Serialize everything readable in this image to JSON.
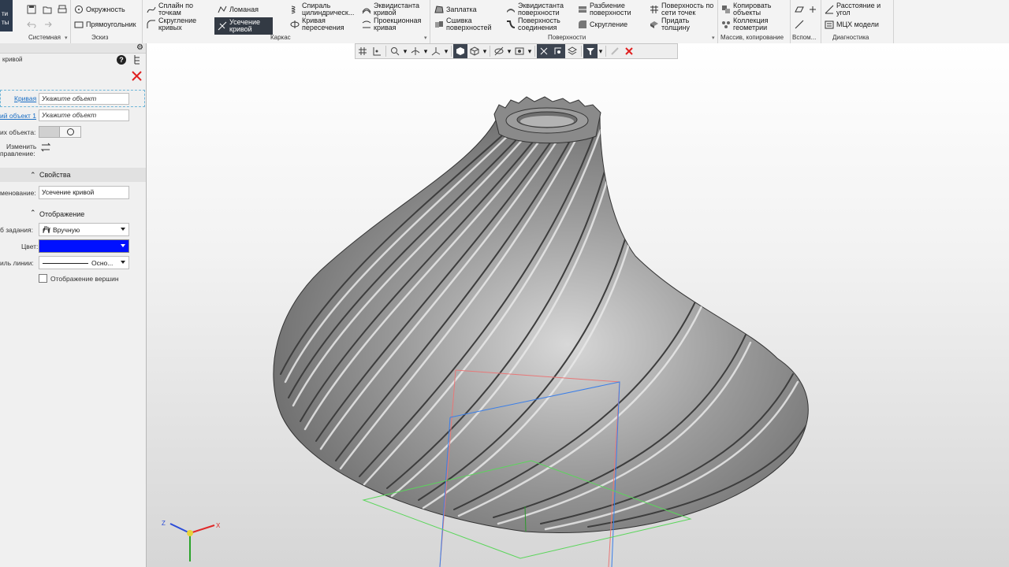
{
  "ribbon": {
    "tab_strip": [
      "ти",
      "ты"
    ],
    "sketch_items": {
      "circle": "Окружность",
      "rectangle": "Прямоугольник"
    },
    "frame_items": {
      "splines_by_points": [
        "Сплайн по",
        "точкам"
      ],
      "polyline": "Ломаная",
      "curve_fillet": [
        "Скругление",
        "кривых"
      ],
      "curve_trim": [
        "Усечение",
        "кривой"
      ],
      "spiral_cylindrical": [
        "Спираль",
        "цилиндрическ..."
      ],
      "intersection_curve": [
        "Кривая",
        "пересечения"
      ],
      "equidistant_curve": [
        "Эквидистанта",
        "кривой"
      ],
      "projection_curve": [
        "Проекционная",
        "кривая"
      ]
    },
    "surface_items": {
      "patch": "Заплатка",
      "stitch_surfaces": [
        "Сшивка",
        "поверхностей"
      ],
      "equidistant_surface": [
        "Эквидистанта",
        "поверхности"
      ],
      "connecting_surface": [
        "Поверхность",
        "соединения"
      ],
      "split_surface": [
        "Разбиение",
        "поверхности"
      ],
      "fillet": "Скругление",
      "surface_by_point_grid": [
        "Поверхность по",
        "сети точек"
      ],
      "add_thickness": [
        "Придать",
        "толщину"
      ]
    },
    "array_items": {
      "copy_objects": [
        "Копировать",
        "объекты"
      ],
      "geometry_collection": [
        "Коллекция",
        "геометрии"
      ]
    },
    "diagnostics_items": {
      "distance_angle": [
        "Расстояние и",
        "угол"
      ],
      "mass_properties": "МЦХ модели"
    },
    "group_labels": {
      "system": "Системная",
      "sketch": "Эскиз",
      "frame": "Каркас",
      "surfaces": "Поверхности",
      "arrays": "Массив, копирование",
      "auxiliary": "Вспом...",
      "diagnostics": "Диагностика"
    }
  },
  "panel": {
    "title": "кривой",
    "curve_label": "Кривая",
    "curve_value": "Укажите объект",
    "object_label": "ий объект 1",
    "object_value": "Укажите объект",
    "object_side_label": "их объекта:",
    "change_direction_label": [
      "Изменить",
      "правление:"
    ],
    "properties_section": "Свойства",
    "name_label": "менование:",
    "name_value": "Усечение кривой",
    "display_section": "Отображение",
    "method_label": "б задания:",
    "method_value": "Вручную",
    "color_label": "Цвет:",
    "color_value": "#0010ff",
    "line_style_label": "иль линии:",
    "line_style_value": "Осно...",
    "show_vertices_label": "Отображение вершин"
  },
  "viewport": {
    "axis_labels": {
      "x": "X",
      "y": "Y",
      "z": "Z"
    },
    "model_color": "#8e8e8e"
  },
  "colors": {
    "accent_dark": "#333a44",
    "close_red": "#e02020",
    "link_blue": "#1a6ec4"
  }
}
